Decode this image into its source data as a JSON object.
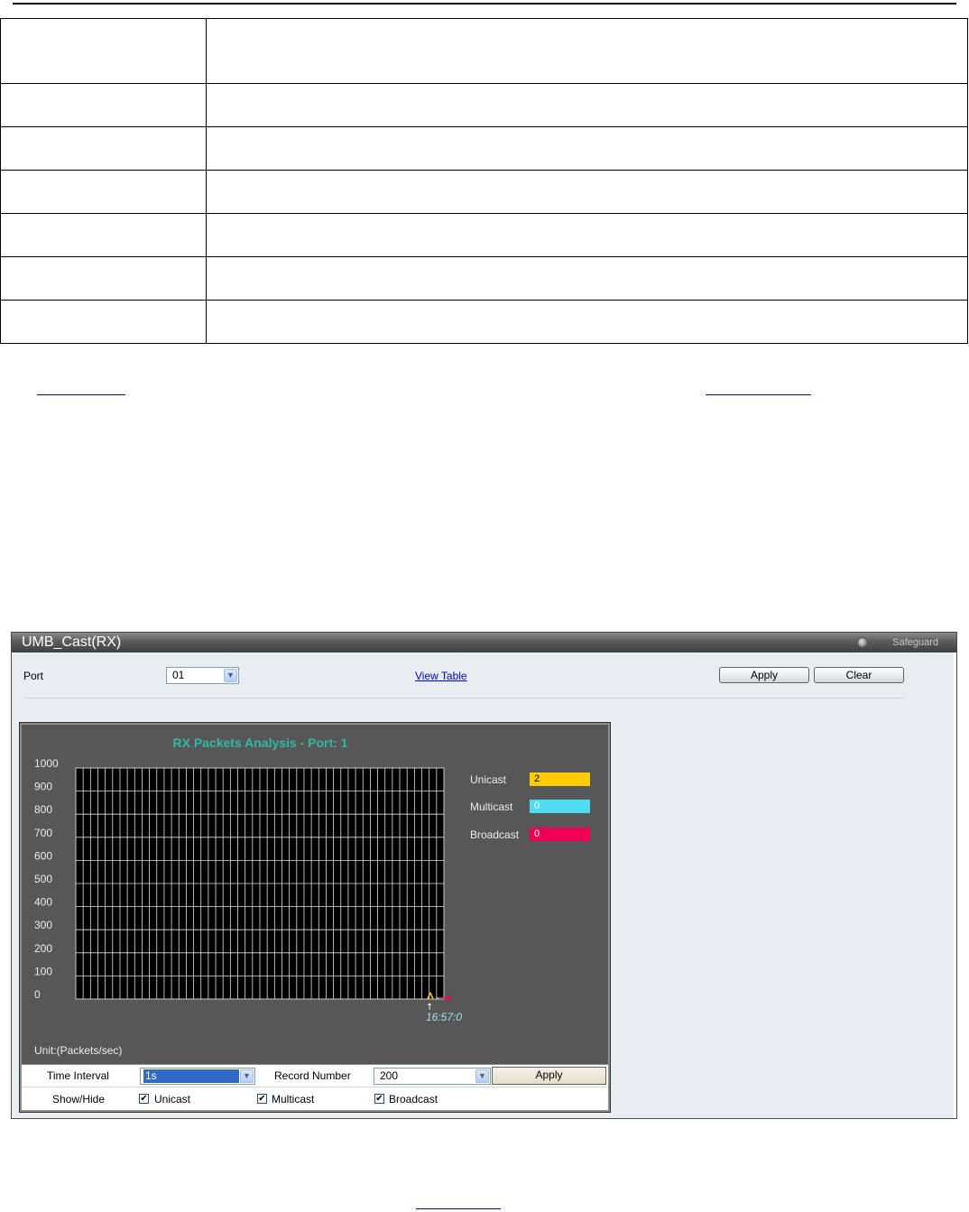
{
  "document": {
    "definition_table_rows": 7
  },
  "window": {
    "title": "UMB_Cast(RX)",
    "safeguard": "Safeguard"
  },
  "form": {
    "port_label": "Port",
    "port_value": "01",
    "view_table": "View Table",
    "apply": "Apply",
    "clear": "Clear"
  },
  "chart_data": {
    "type": "line",
    "title": "RX Packets Analysis - Port: 1",
    "ylim": [
      0,
      1000
    ],
    "y_ticks": [
      "1000",
      "900",
      "800",
      "700",
      "600",
      "500",
      "400",
      "300",
      "200",
      "100",
      "0"
    ],
    "x_ticks": [
      "16:57:0"
    ],
    "unit": "Unit:(Packets/sec)",
    "grid": true,
    "series": [
      {
        "name": "Unicast",
        "value": "2",
        "color": "#ffcc00"
      },
      {
        "name": "Multicast",
        "value": "0",
        "color": "#4ddcf0"
      },
      {
        "name": "Broadcast",
        "value": "0",
        "color": "#ee0055"
      }
    ]
  },
  "controls": {
    "time_interval_label": "Time Interval",
    "time_interval_value": "1s",
    "record_number_label": "Record Number",
    "record_number_value": "200",
    "apply": "Apply",
    "show_hide_label": "Show/Hide",
    "unicast": "Unicast",
    "multicast": "Multicast",
    "broadcast": "Broadcast",
    "unicast_checked": true,
    "multicast_checked": true,
    "broadcast_checked": true
  }
}
